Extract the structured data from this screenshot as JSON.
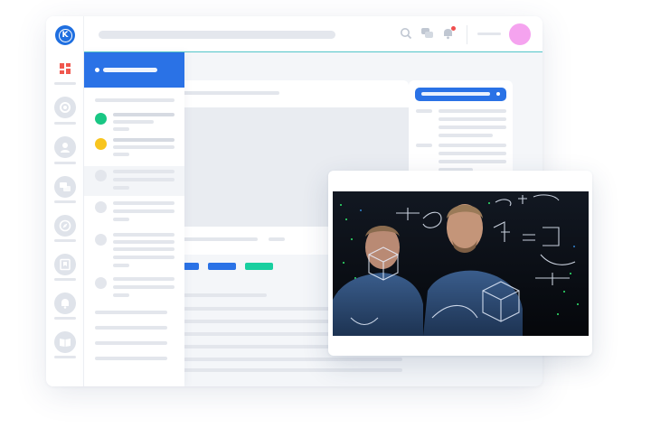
{
  "brand": {
    "logo_letter": "K"
  },
  "colors": {
    "accent": "#2a72e6",
    "header_rule": "#52c5c9",
    "status_green": "#19c784",
    "status_yellow": "#f8c51e",
    "tag_teal": "#19cfa0",
    "avatar": "#f5a3ef",
    "notification_dot": "#f04e4e"
  },
  "rail": {
    "items": [
      {
        "icon": "dashboard-icon",
        "active": true
      },
      {
        "icon": "lifebuoy-icon"
      },
      {
        "icon": "user-icon"
      },
      {
        "icon": "chat-bubbles-icon"
      },
      {
        "icon": "compass-icon"
      },
      {
        "icon": "bookmark-icon"
      },
      {
        "icon": "bell-icon"
      },
      {
        "icon": "book-icon"
      }
    ]
  },
  "topbar": {
    "icons": [
      "search-icon",
      "chat-icon",
      "bell-icon"
    ],
    "has_notification": true
  },
  "panel": {
    "channels": [
      {
        "status": "green"
      },
      {
        "status": "yellow"
      },
      {
        "status": "none",
        "selected": true
      },
      {
        "status": "none"
      },
      {
        "status": "none"
      },
      {
        "status": "none"
      }
    ]
  },
  "video": {
    "description_icon": "video-player"
  }
}
